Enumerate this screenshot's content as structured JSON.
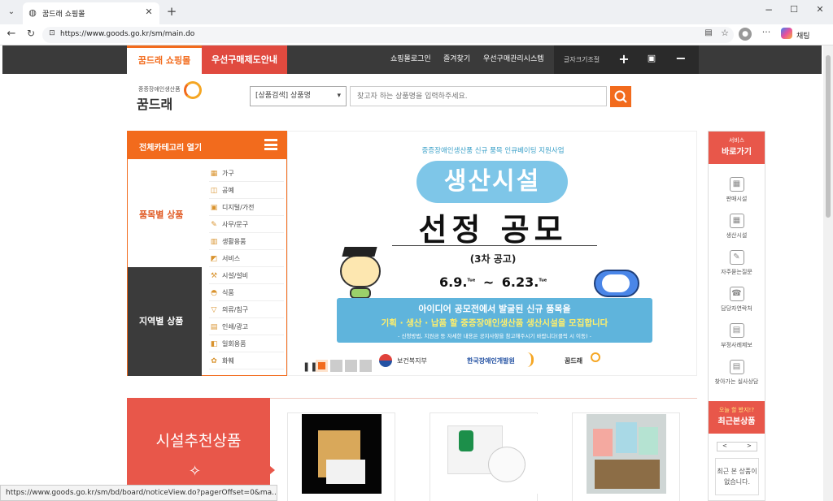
{
  "browser": {
    "tab_title": "꿈드래 쇼핑몰",
    "url": "https://www.goods.go.kr/sm/main.do",
    "chat_label": "채팅",
    "status_url": "https://www.goods.go.kr/sm/bd/board/noticeView.do?pagerOffset=0&ma..."
  },
  "topnav": {
    "tab_shop": "꿈드래 쇼핑몰",
    "tab_guide": "우선구매제도안내",
    "links": [
      "쇼핑몰로그인",
      "즐겨찾기",
      "우선구매관리시스템"
    ],
    "font_adjust": "글자크기조절"
  },
  "logo": {
    "small": "중증장애인생산품",
    "main": "꿈드래"
  },
  "search": {
    "select_value": "[상품검색] 상품명",
    "placeholder": "찾고자 하는 상품명을 입력하주세요."
  },
  "category": {
    "header": "전체카테고리 열기",
    "by_item": "품목별 상품",
    "by_region": "지역별 상품",
    "items": [
      {
        "label": "가구",
        "icon": "▦"
      },
      {
        "label": "공예",
        "icon": "◫"
      },
      {
        "label": "디지털/가전",
        "icon": "▣"
      },
      {
        "label": "사무/문구",
        "icon": "✎"
      },
      {
        "label": "생활용품",
        "icon": "▥"
      },
      {
        "label": "서비스",
        "icon": "◩"
      },
      {
        "label": "시설/설비",
        "icon": "⚒"
      },
      {
        "label": "식품",
        "icon": "◓"
      },
      {
        "label": "의류/침구",
        "icon": "▽"
      },
      {
        "label": "인쇄/광고",
        "icon": "▤"
      },
      {
        "label": "일회용품",
        "icon": "◧"
      },
      {
        "label": "화훼",
        "icon": "✿"
      }
    ]
  },
  "banner": {
    "kicker": "중증장애인생산품 신규 품목 인큐베이팅 지원사업",
    "title1": "생산시설",
    "title2": "선정 공모",
    "round": "(3차 공고)",
    "date_start": "6.9.",
    "date_start_day": "Tue",
    "tilde": "~",
    "date_end": "6.23.",
    "date_end_day": "Tue",
    "line1": "아이디어 공모전에서 발굴된 신규 품목을",
    "line2": "기획 · 생산 · 납품 할 중증장애인생산품 생산시설을 모집합니다",
    "line3": "- 신청방법, 지원금 등 자세한 내용은 공지사항을 참고해주시기 바랍니다(클릭 시 이동) -",
    "logo1": "보건복지부",
    "logo2": "한국장애인개발원",
    "logo3": "꿈드래"
  },
  "rail": {
    "top_small": "서비스",
    "top_big": "바로가기",
    "items": [
      "판매시설",
      "생산시설",
      "자주묻는질문",
      "담당자연락처",
      "부정사례제보",
      "찾아가는 실사상담"
    ],
    "recent_small": "오늘 할 봤지!?",
    "recent_big": "최근본상품",
    "recent_empty": "최근 본 상품이 없습니다.",
    "prev": "<",
    "next": ">"
  },
  "recommend": {
    "title": "시설추천상품"
  },
  "colors": {
    "accent": "#f26b1d",
    "red": "#e8574a",
    "dark": "#3a3a3a"
  }
}
